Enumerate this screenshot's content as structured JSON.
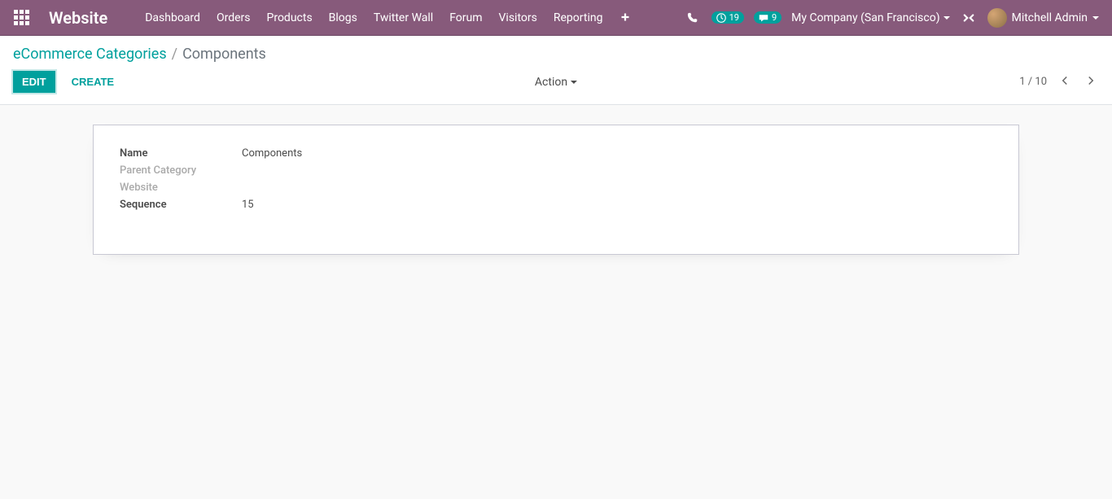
{
  "navbar": {
    "brand": "Website",
    "menu": [
      "Dashboard",
      "Orders",
      "Products",
      "Blogs",
      "Twitter Wall",
      "Forum",
      "Visitors",
      "Reporting"
    ],
    "activities_count": "19",
    "messages_count": "9",
    "company": "My Company (San Francisco)",
    "user": "Mitchell Admin"
  },
  "breadcrumb": {
    "parent": "eCommerce Categories",
    "current": "Components"
  },
  "buttons": {
    "edit": "EDIT",
    "create": "CREATE",
    "action": "Action"
  },
  "pager": {
    "text": "1 / 10"
  },
  "form": {
    "labels": {
      "name": "Name",
      "parent_category": "Parent Category",
      "website": "Website",
      "sequence": "Sequence"
    },
    "values": {
      "name": "Components",
      "parent_category": "",
      "website": "",
      "sequence": "15"
    }
  }
}
